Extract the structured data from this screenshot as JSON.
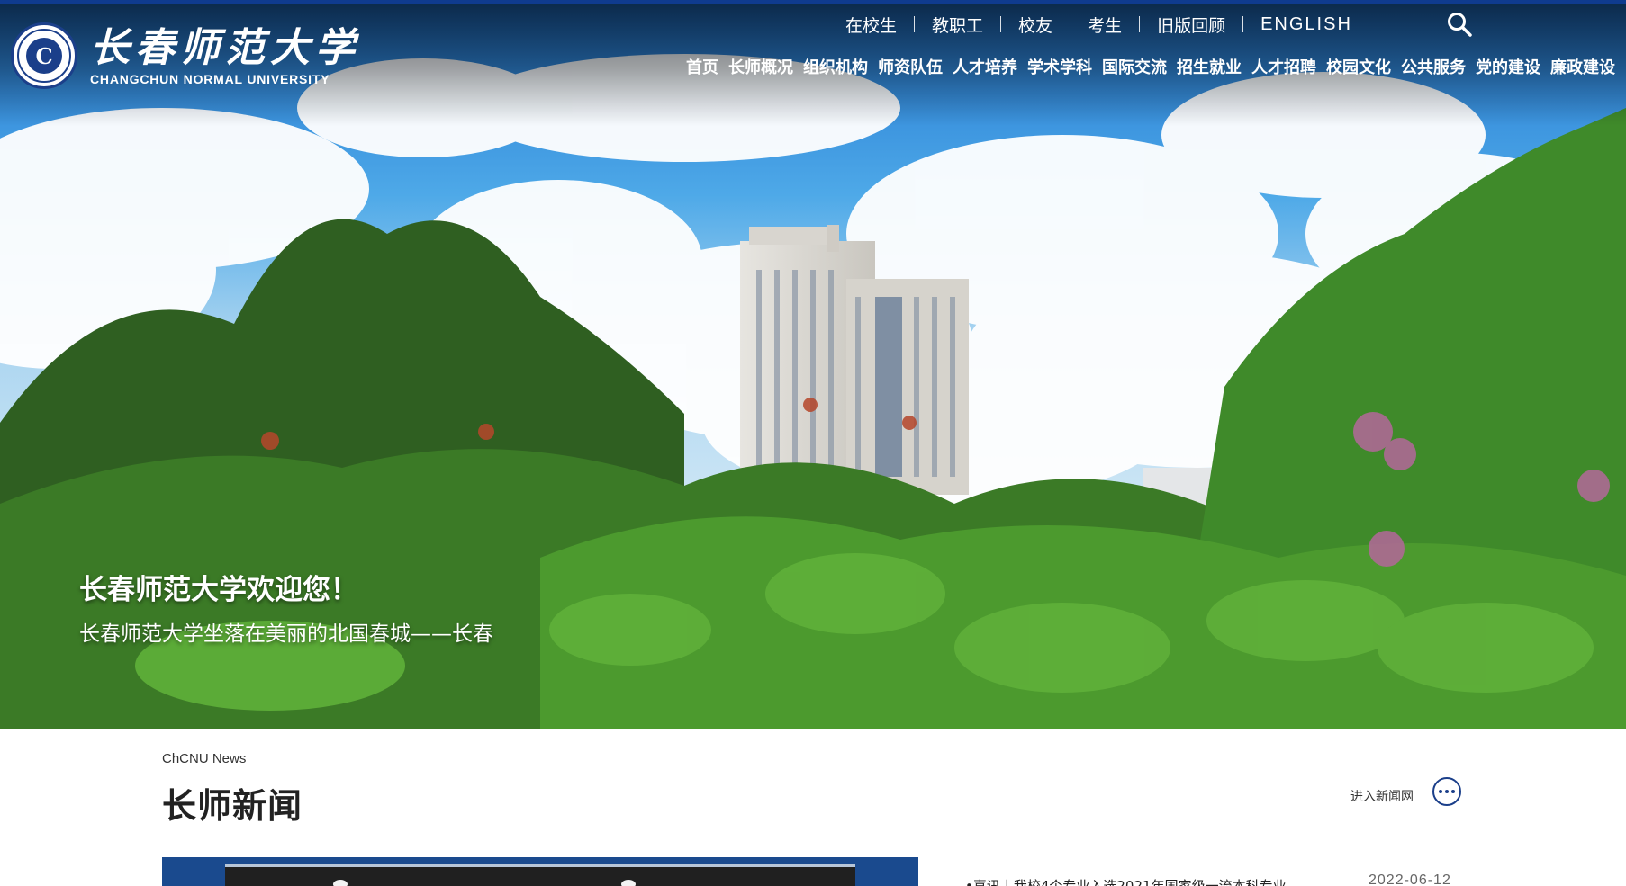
{
  "brand": {
    "name_cn": "长春师范大学",
    "name_en": "CHANGCHUN NORMAL UNIVERSITY"
  },
  "top_links": [
    "在校生",
    "教职工",
    "校友",
    "考生",
    "旧版回顾",
    "ENGLISH"
  ],
  "main_nav": [
    "首页",
    "长师概况",
    "组织机构",
    "师资队伍",
    "人才培养",
    "学术学科",
    "国际交流",
    "招生就业",
    "人才招聘",
    "校园文化",
    "公共服务",
    "党的建设",
    "廉政建设"
  ],
  "search": {
    "icon": "search-icon"
  },
  "hero": {
    "title": "长春师范大学欢迎您！",
    "subtitle": "长春师范大学坐落在美丽的北国春城——长春"
  },
  "news": {
    "eyebrow": "ChCNU News",
    "title": "长师新闻",
    "more_label": "进入新闻网",
    "more_icon": "more-dots-icon",
    "items": [
      {
        "title": "•喜讯丨我校4个专业入选2021年国家级一流本科专业",
        "date": "2022-06-12"
      }
    ]
  },
  "colors": {
    "accent": "#1b3f8a",
    "top_bar": "#0f3b8f",
    "text_dark": "#222222"
  }
}
